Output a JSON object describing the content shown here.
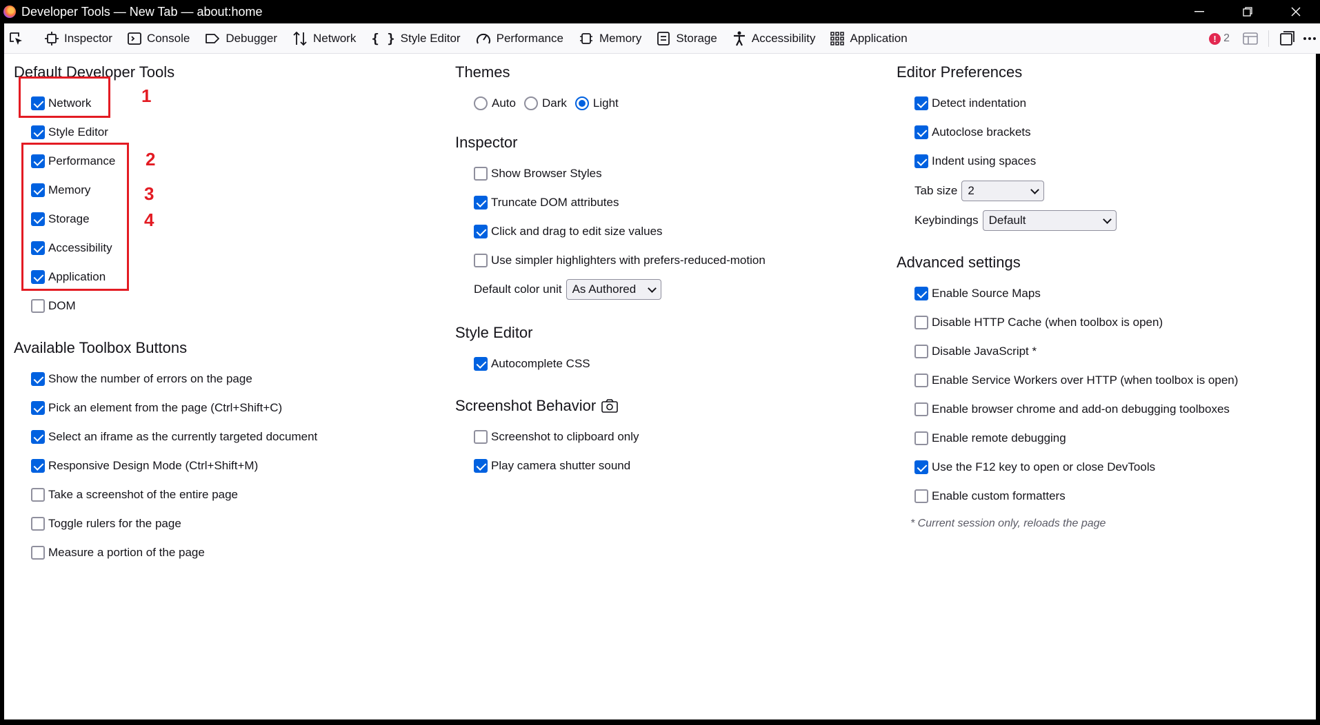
{
  "window": {
    "title": "Developer Tools — New Tab — about:home",
    "controls": [
      "minimize",
      "restore",
      "close"
    ]
  },
  "toolbar": {
    "tabs": [
      {
        "label": "Inspector",
        "icon": "inspector-icon"
      },
      {
        "label": "Console",
        "icon": "console-icon"
      },
      {
        "label": "Debugger",
        "icon": "debugger-icon"
      },
      {
        "label": "Network",
        "icon": "network-icon"
      },
      {
        "label": "Style Editor",
        "icon": "style-editor-icon"
      },
      {
        "label": "Performance",
        "icon": "performance-icon"
      },
      {
        "label": "Memory",
        "icon": "memory-icon"
      },
      {
        "label": "Storage",
        "icon": "storage-icon"
      },
      {
        "label": "Accessibility",
        "icon": "accessibility-icon"
      },
      {
        "label": "Application",
        "icon": "application-icon"
      }
    ],
    "error_count": "2"
  },
  "default_tools": {
    "title": "Default Developer Tools",
    "items": [
      {
        "label": "Network",
        "checked": true
      },
      {
        "label": "Style Editor",
        "checked": true
      },
      {
        "label": "Performance",
        "checked": true
      },
      {
        "label": "Memory",
        "checked": true
      },
      {
        "label": "Storage",
        "checked": true
      },
      {
        "label": "Accessibility",
        "checked": true
      },
      {
        "label": "Application",
        "checked": true
      },
      {
        "label": "DOM",
        "checked": false
      }
    ]
  },
  "toolbox_buttons": {
    "title": "Available Toolbox Buttons",
    "items": [
      {
        "label": "Show the number of errors on the page",
        "checked": true
      },
      {
        "label": "Pick an element from the page (Ctrl+Shift+C)",
        "checked": true
      },
      {
        "label": "Select an iframe as the currently targeted document",
        "checked": true
      },
      {
        "label": "Responsive Design Mode (Ctrl+Shift+M)",
        "checked": true
      },
      {
        "label": "Take a screenshot of the entire page",
        "checked": false
      },
      {
        "label": "Toggle rulers for the page",
        "checked": false
      },
      {
        "label": "Measure a portion of the page",
        "checked": false
      }
    ]
  },
  "themes": {
    "title": "Themes",
    "options": [
      "Auto",
      "Dark",
      "Light"
    ],
    "selected": "Light"
  },
  "inspector": {
    "title": "Inspector",
    "items": [
      {
        "label": "Show Browser Styles",
        "checked": false
      },
      {
        "label": "Truncate DOM attributes",
        "checked": true
      },
      {
        "label": "Click and drag to edit size values",
        "checked": true
      },
      {
        "label": "Use simpler highlighters with prefers-reduced-motion",
        "checked": false
      }
    ],
    "color_unit_label": "Default color unit",
    "color_unit_value": "As Authored"
  },
  "style_editor": {
    "title": "Style Editor",
    "items": [
      {
        "label": "Autocomplete CSS",
        "checked": true
      }
    ]
  },
  "screenshot": {
    "title": "Screenshot Behavior",
    "items": [
      {
        "label": "Screenshot to clipboard only",
        "checked": false
      },
      {
        "label": "Play camera shutter sound",
        "checked": true
      }
    ]
  },
  "editor_prefs": {
    "title": "Editor Preferences",
    "items": [
      {
        "label": "Detect indentation",
        "checked": true
      },
      {
        "label": "Autoclose brackets",
        "checked": true
      },
      {
        "label": "Indent using spaces",
        "checked": true
      }
    ],
    "tab_size_label": "Tab size",
    "tab_size_value": "2",
    "keybindings_label": "Keybindings",
    "keybindings_value": "Default"
  },
  "advanced": {
    "title": "Advanced settings",
    "items": [
      {
        "label": "Enable Source Maps",
        "checked": true
      },
      {
        "label": "Disable HTTP Cache (when toolbox is open)",
        "checked": false
      },
      {
        "label": "Disable JavaScript *",
        "checked": false
      },
      {
        "label": "Enable Service Workers over HTTP (when toolbox is open)",
        "checked": false
      },
      {
        "label": "Enable browser chrome and add-on debugging toolboxes",
        "checked": false
      },
      {
        "label": "Enable remote debugging",
        "checked": false
      },
      {
        "label": "Use the F12 key to open or close DevTools",
        "checked": true
      },
      {
        "label": "Enable custom formatters",
        "checked": false
      }
    ],
    "note": "* Current session only, reloads the page"
  },
  "annotations": [
    "1",
    "2",
    "3",
    "4"
  ],
  "colors": {
    "accent": "#0061e0",
    "annotation": "#e31b23",
    "error": "#e22850"
  }
}
